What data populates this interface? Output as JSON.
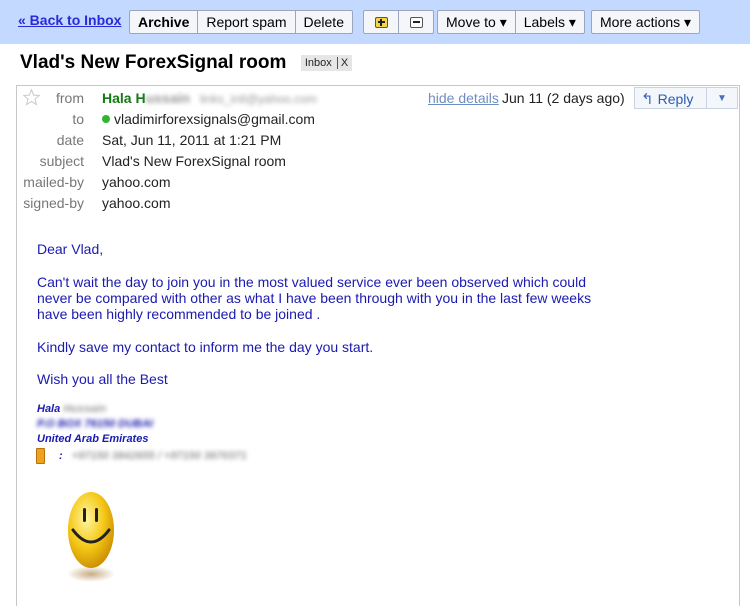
{
  "toolbar": {
    "back_link": "« Back to Inbox",
    "archive": "Archive",
    "report_spam": "Report spam",
    "delete": "Delete",
    "move_to": "Move to ▾",
    "labels": "Labels ▾",
    "more_actions": "More actions ▾"
  },
  "thread": {
    "subject": "Vlad's New ForexSignal room",
    "label_chip": "Inbox",
    "label_remove": "X"
  },
  "header": {
    "from_label": "from",
    "from_name": "Hala H",
    "from_name_blurred": "ussain",
    "from_email_blurred": "links_intl@yahoo.com",
    "hide_details": "hide details",
    "date_short": "Jun 11 (2 days ago)",
    "reply": "Reply",
    "to_label": "to",
    "to_value": "vladimirforexsignals@gmail.com",
    "date_label": "date",
    "date_value": "Sat, Jun 11, 2011 at 1:21 PM",
    "subject_label": "subject",
    "subject_value": "Vlad's New ForexSignal room",
    "mailed_by_label": "mailed-by",
    "mailed_by_value": "yahoo.com",
    "signed_by_label": "signed-by",
    "signed_by_value": "yahoo.com"
  },
  "body": {
    "greeting": "Dear Vlad,",
    "p1_line1": "Can't wait the day to join you in the most valued service ever been observed which could",
    "p1_line2": "never be compared with other as what I have been through with you in the last few weeks",
    "p1_line3": "have been highly recommended to be joined .",
    "p2": "Kindly save my contact to inform me the day you start.",
    "p3": "Wish you all the Best"
  },
  "signature": {
    "name": "Hala",
    "name_blurred": "Hussain",
    "po_box_blurred": "P.O BOX 76150 DUBAI",
    "country": "United Arab Emirates",
    "phone_sep": ":",
    "phones_blurred": "+97150 3842655 / +97150 3670371"
  },
  "colors": {
    "toolbar_bg": "#c3d9ff",
    "link": "#2a2ad8",
    "body_text": "#1a1ab0",
    "sender_green": "#137a13"
  }
}
